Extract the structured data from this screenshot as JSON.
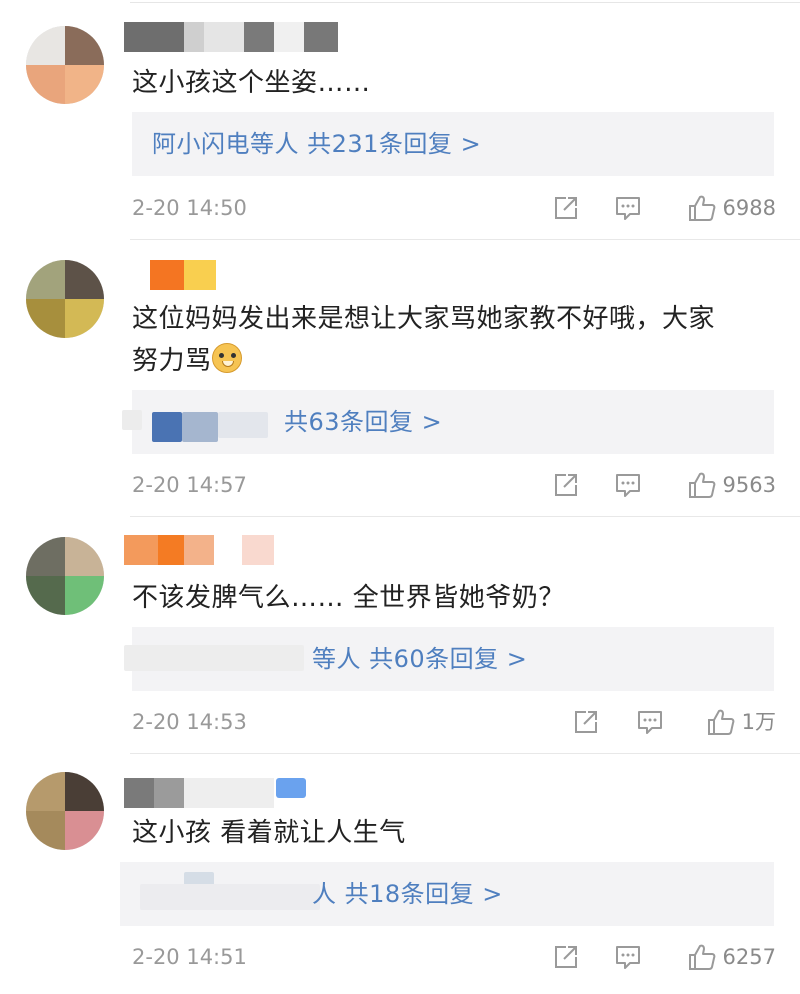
{
  "comments": [
    {
      "text": "这小孩这个坐姿……",
      "reply_text": "阿小闪电等人 共231条回复 >",
      "time": "2-20 14:50",
      "likes": "6988"
    },
    {
      "text_line1": "这位妈妈发出来是想让大家骂她家教不好哦，大家",
      "text_line2": "努力骂",
      "reply_text": "共63条回复 >",
      "time": "2-20 14:57",
      "likes": "9563"
    },
    {
      "text": "不该发脾气么…… 全世界皆她爷奶？",
      "reply_text": "等人 共60条回复 >",
      "time": "2-20 14:53",
      "likes": "1万"
    },
    {
      "text": "这小孩 看着就让人生气",
      "reply_text": "人 共18条回复 >",
      "time": "2-20 14:51",
      "likes": "6257"
    }
  ],
  "icons": {
    "share": "share-icon",
    "comment": "comment-icon",
    "like": "thumbs-up-icon"
  },
  "colors": {
    "link": "#4f7fbf",
    "meta": "#999999",
    "reply_bg": "#f3f3f5"
  }
}
